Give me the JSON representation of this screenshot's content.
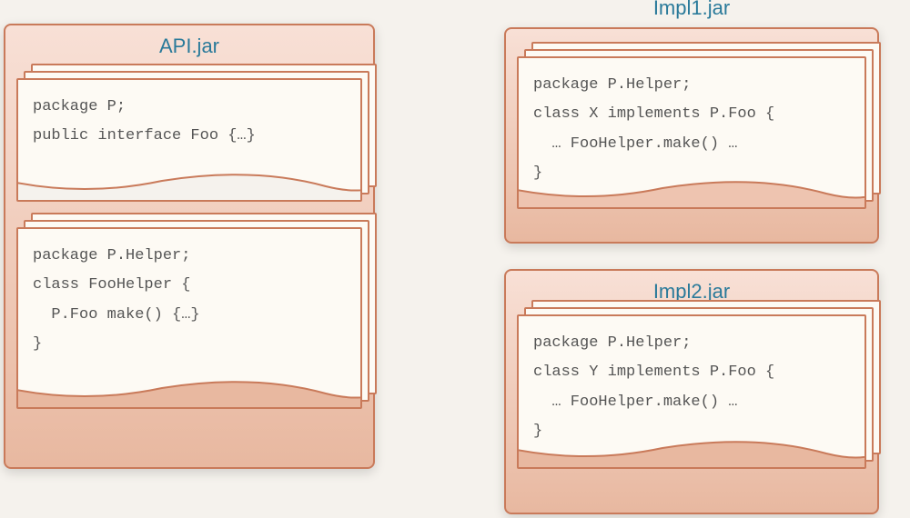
{
  "jars": {
    "api": {
      "title": "API.jar",
      "sheets": [
        {
          "lines": [
            "package P;",
            "",
            "public interface Foo {…}"
          ]
        },
        {
          "lines": [
            "package P.Helper;",
            "",
            "class FooHelper {",
            "  P.Foo make() {…}",
            "}"
          ]
        }
      ]
    },
    "impl1": {
      "title": "Impl1.jar",
      "sheets": [
        {
          "lines": [
            "package P.Helper;",
            "class X implements P.Foo {",
            "  … FooHelper.make() …",
            "}"
          ]
        }
      ]
    },
    "impl2": {
      "title": "Impl2.jar",
      "sheets": [
        {
          "lines": [
            "package P.Helper;",
            "class Y implements P.Foo {",
            "  … FooHelper.make() …",
            "}"
          ]
        }
      ]
    }
  },
  "colors": {
    "jar_border": "#c97a5a",
    "jar_bg_top": "#f8e0d6",
    "jar_bg_bottom": "#e8b8a0",
    "sheet_bg": "#fdfaf4",
    "title_color": "#2a7a9a",
    "code_color": "#555555"
  }
}
